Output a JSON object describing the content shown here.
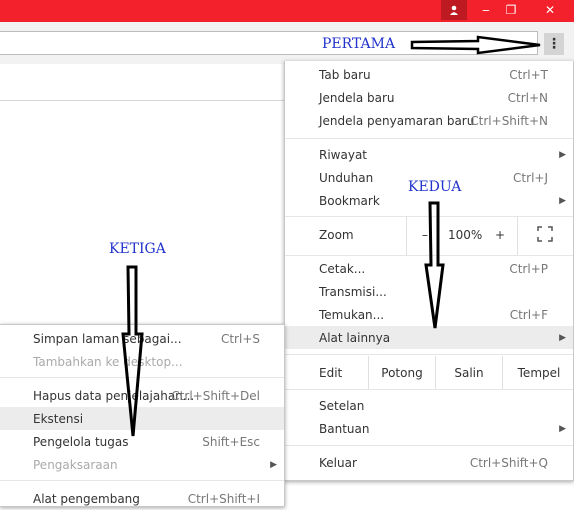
{
  "window": {
    "user_icon": "person-icon",
    "min": "‒",
    "max": "❐",
    "close": "✕"
  },
  "toolbar": {
    "menu_glyph": "⋮"
  },
  "main_menu": {
    "new_tab": {
      "label": "Tab baru",
      "shortcut": "Ctrl+T"
    },
    "new_window": {
      "label": "Jendela baru",
      "shortcut": "Ctrl+N"
    },
    "incognito": {
      "label": "Jendela penyamaran baru",
      "shortcut": "Ctrl+Shift+N"
    },
    "history": {
      "label": "Riwayat"
    },
    "downloads": {
      "label": "Unduhan",
      "shortcut": "Ctrl+J"
    },
    "bookmarks": {
      "label": "Bookmark"
    },
    "zoom": {
      "label": "Zoom",
      "minus": "–",
      "value": "100%",
      "plus": "+"
    },
    "print": {
      "label": "Cetak...",
      "shortcut": "Ctrl+P"
    },
    "cast": {
      "label": "Transmisi..."
    },
    "find": {
      "label": "Temukan...",
      "shortcut": "Ctrl+F"
    },
    "more_tools": {
      "label": "Alat lainnya"
    },
    "edit": {
      "label": "Edit",
      "cut": "Potong",
      "copy": "Salin",
      "paste": "Tempel"
    },
    "settings": {
      "label": "Setelan"
    },
    "help": {
      "label": "Bantuan"
    },
    "exit": {
      "label": "Keluar",
      "shortcut": "Ctrl+Shift+Q"
    }
  },
  "sub_menu": {
    "save_page": {
      "label": "Simpan laman sebagai...",
      "shortcut": "Ctrl+S"
    },
    "add_desktop": {
      "label": "Tambahkan ke desktop..."
    },
    "clear_data": {
      "label": "Hapus data penjelajahan...",
      "shortcut": "Ctrl+Shift+Del"
    },
    "extensions": {
      "label": "Ekstensi"
    },
    "task_manager": {
      "label": "Pengelola tugas",
      "shortcut": "Shift+Esc"
    },
    "encoding": {
      "label": "Pengaksaraan"
    },
    "dev_tools": {
      "label": "Alat pengembang",
      "shortcut": "Ctrl+Shift+I"
    }
  },
  "annotations": {
    "first": "PERTAMA",
    "second": "KEDUA",
    "third": "KETIGA"
  },
  "colors": {
    "titlebar": "#f2212b",
    "annotation": "#2233cc"
  }
}
